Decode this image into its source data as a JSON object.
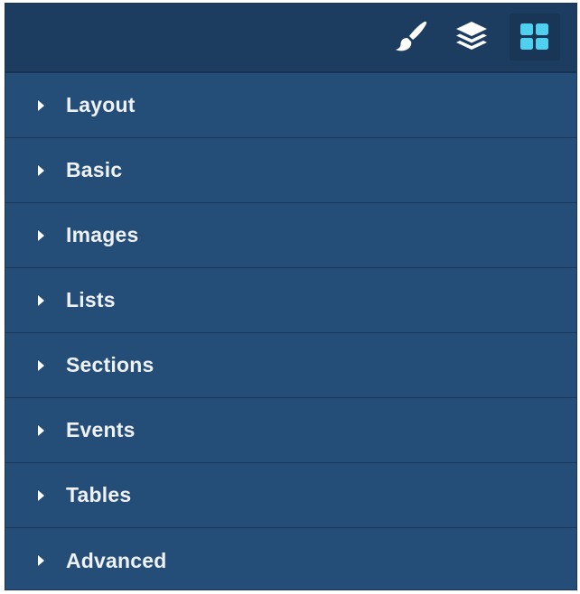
{
  "toolbar": {
    "buttons": [
      {
        "icon": "paint-brush-icon",
        "active": false
      },
      {
        "icon": "layers-icon",
        "active": false
      },
      {
        "icon": "blocks-grid-icon",
        "active": true
      }
    ],
    "colors": {
      "icon_default": "#ffffff",
      "icon_active": "#4fd0ee",
      "panel_bg": "#244d78",
      "topbar_bg": "#1d3d60"
    }
  },
  "categories": [
    {
      "label": "Layout"
    },
    {
      "label": "Basic"
    },
    {
      "label": "Images"
    },
    {
      "label": "Lists"
    },
    {
      "label": "Sections"
    },
    {
      "label": "Events"
    },
    {
      "label": "Tables"
    },
    {
      "label": "Advanced"
    }
  ]
}
